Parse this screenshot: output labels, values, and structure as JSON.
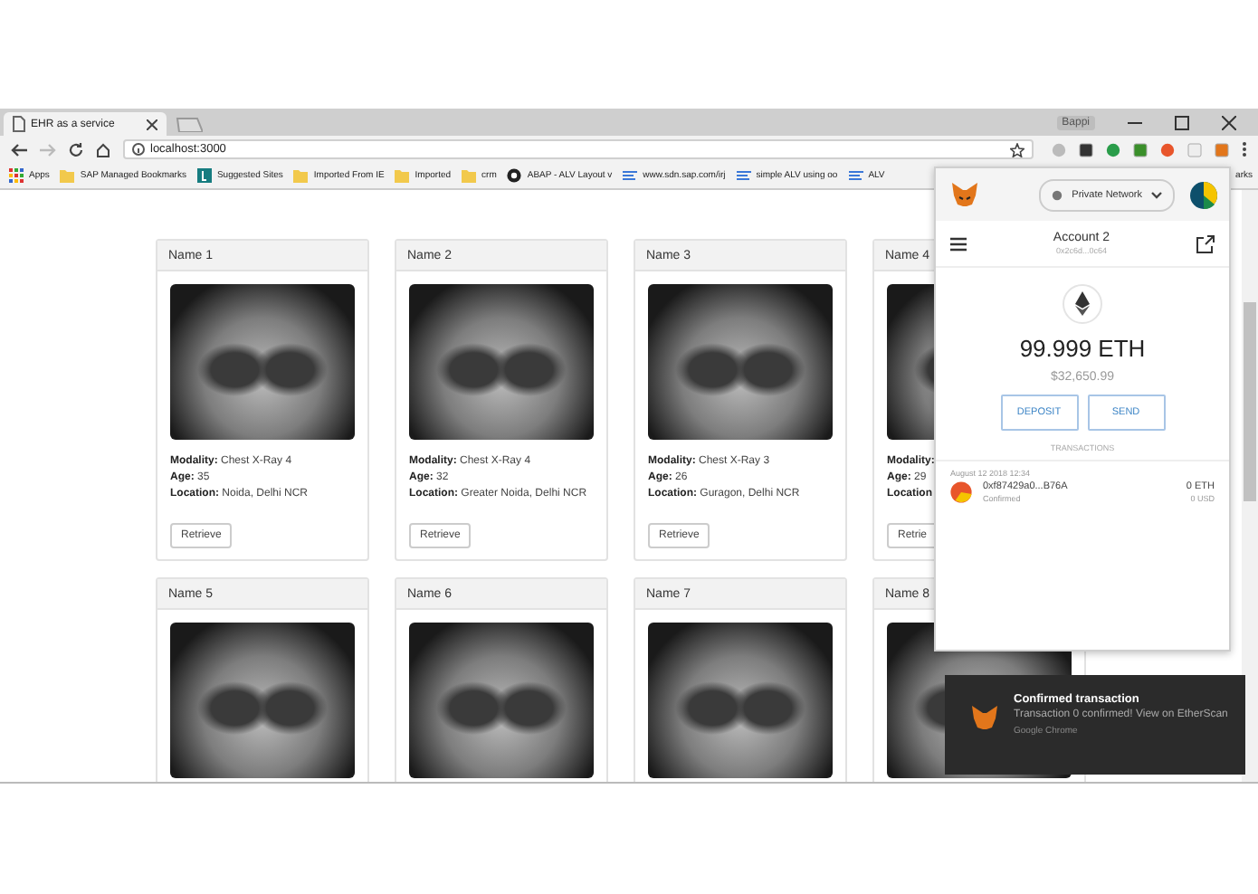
{
  "browser": {
    "tabs": [
      {
        "title": "EHR as a service",
        "selected": true
      }
    ],
    "profile": "Bappi",
    "address": "localhost:3000",
    "bookmarks": [
      {
        "label": "Apps",
        "kind": "apps"
      },
      {
        "label": "SAP Managed Bookmarks",
        "kind": "folder"
      },
      {
        "label": "Suggested Sites",
        "kind": "site"
      },
      {
        "label": "Imported From IE",
        "kind": "folder"
      },
      {
        "label": "Imported",
        "kind": "folder"
      },
      {
        "label": "crm",
        "kind": "folder"
      },
      {
        "label": "ABAP - ALV Layout v",
        "kind": "abap"
      },
      {
        "label": "www.sdn.sap.com/irj",
        "kind": "link"
      },
      {
        "label": "simple ALV using oo",
        "kind": "link"
      },
      {
        "label": "ALV",
        "kind": "link"
      },
      {
        "label": "arks",
        "kind": "text"
      }
    ]
  },
  "cards": [
    {
      "name": "Name 1",
      "fields": [
        {
          "label": "Modality:",
          "value": "Chest X-Ray 4"
        },
        {
          "label": "Age:",
          "value": "35"
        },
        {
          "label": "Location:",
          "value": "Noida, Delhi NCR"
        }
      ],
      "button": "Retrieve"
    },
    {
      "name": "Name 2",
      "fields": [
        {
          "label": "Modality:",
          "value": "Chest X-Ray 4"
        },
        {
          "label": "Age:",
          "value": "32"
        },
        {
          "label": "Location:",
          "value": "Greater Noida, Delhi NCR"
        }
      ],
      "button": "Retrieve"
    },
    {
      "name": "Name 3",
      "fields": [
        {
          "label": "Modality:",
          "value": "Chest X-Ray 3"
        },
        {
          "label": "Age:",
          "value": "26"
        },
        {
          "label": "Location:",
          "value": "Guragon, Delhi NCR"
        }
      ],
      "button": "Retrieve"
    },
    {
      "name": "Name 4",
      "fields": [
        {
          "label": "Modality:"
        },
        {
          "label": "Age:",
          "value": "29"
        },
        {
          "label": "Location"
        }
      ],
      "button": "Retrie"
    },
    {
      "name": "Name 5"
    },
    {
      "name": "Name 6"
    },
    {
      "name": "Name 7"
    },
    {
      "name": "Name 8"
    }
  ],
  "wallet": {
    "network": "Private Network",
    "account": "Account 2",
    "address": "0x2c6d...0c64",
    "balance": "99.999 ETH",
    "fiat": "$32,650.99",
    "buttons": [
      "DEPOSIT",
      "SEND"
    ],
    "section": "TRANSACTIONS",
    "transactions": [
      {
        "date": "August 12 2018 12:34",
        "hash": "0xf87429a0...B76A",
        "status": "Confirmed",
        "amount": "0 ETH",
        "fiat": "0 USD"
      }
    ]
  },
  "notification": {
    "title": "Confirmed transaction",
    "message": "Transaction 0 confirmed! View on EtherScan",
    "source": "Google Chrome"
  }
}
